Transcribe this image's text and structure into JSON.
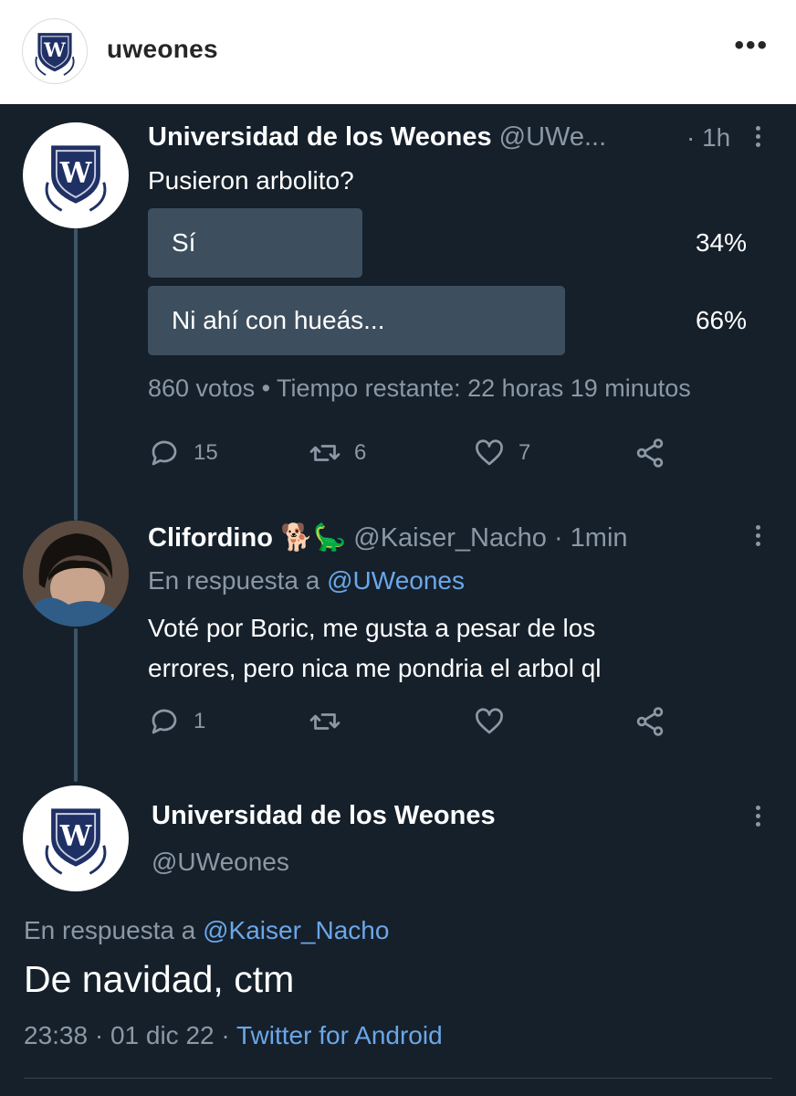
{
  "ig_header": {
    "username": "uweones",
    "more_icon": "ellipsis-icon"
  },
  "poll_tweet": {
    "name": "Universidad de los Weones",
    "handle": "@UWe...",
    "time": "· 1h",
    "text": "Pusieron arbolito?",
    "options": [
      {
        "label": "Sí",
        "percent_text": "34%",
        "percent": 34
      },
      {
        "label": "Ni ahí con hueás...",
        "percent_text": "66%",
        "percent": 66
      }
    ],
    "poll_meta": "860 votos • Tiempo restante: 22 horas 19 minutos",
    "actions": {
      "replies": "15",
      "retweets": "6",
      "likes": "7"
    }
  },
  "reply_tweet": {
    "name": "Clifordino 🐕🦕",
    "handle": "@Kaiser_Nacho",
    "time": "· 1min",
    "reply_prefix": "En respuesta a ",
    "reply_to": "@UWeones",
    "text_line1": "Voté por Boric, me gusta a pesar de los",
    "text_line2": "errores, pero nica me pondria el arbol ql",
    "actions": {
      "replies": "1"
    }
  },
  "main_tweet": {
    "name": "Universidad de los Weones",
    "handle": "@UWeones",
    "reply_prefix": "En respuesta a ",
    "reply_to": "@Kaiser_Nacho",
    "text": "De navidad, ctm",
    "time": "23:38",
    "date": "· 01 dic 22 ·",
    "source": "Twitter for Android"
  },
  "colors": {
    "background": "#15202b",
    "secondary_text": "#8b98a5",
    "link": "#6ba7e8",
    "poll_bar": "#3d4e5e"
  }
}
